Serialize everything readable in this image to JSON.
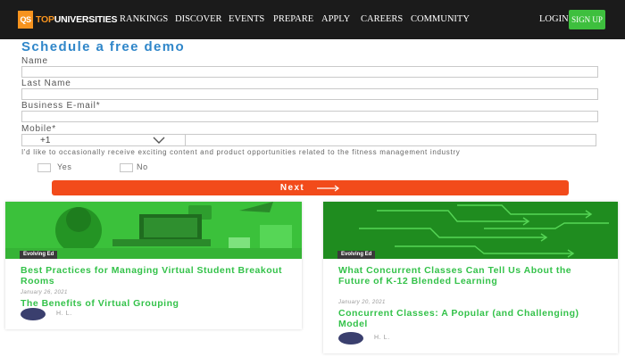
{
  "nav": {
    "logo_mark": "QS",
    "logo_top": "TOP",
    "logo_rest": "UNIVERSITIES",
    "links": [
      "RANKINGS",
      "DISCOVER",
      "EVENTS",
      "PREPARE",
      "APPLY",
      "CAREERS",
      "COMMUNITY"
    ],
    "login": "LOGIN",
    "signup": "SIGN UP"
  },
  "form": {
    "title": "Schedule a free demo",
    "name_label": "Name",
    "last_name_label": "Last Name",
    "email_label": "Business E-mail*",
    "mobile_label": "Mobile*",
    "country_code": "+1",
    "consent": "I'd like to occasionally receive exciting content and product opportunities related to the fitness management industry",
    "yes_label": "Yes",
    "no_label": "No",
    "next_label": "Next"
  },
  "cards": [
    {
      "badge": "Evolving Ed",
      "title": "Best Practices for Managing Virtual Student Breakout Rooms",
      "date": "January 26, 2021",
      "related_title": "The Benefits of Virtual Grouping",
      "author": "H. L."
    },
    {
      "badge": "Evolving Ed",
      "title": "What Concurrent Classes Can Tell Us About the Future of K-12 Blended Learning",
      "date": "January 20, 2021",
      "related_title": "Concurrent Classes: A Popular (and Challenging) Model",
      "author": "H. L."
    }
  ],
  "colors": {
    "nav_bg": "#1b1b1b",
    "accent_orange": "#f7931e",
    "signup_green": "#3ebf3e",
    "title_blue": "#2f86c9",
    "next_button": "#f24b1b",
    "card_green": "#34c24a"
  }
}
